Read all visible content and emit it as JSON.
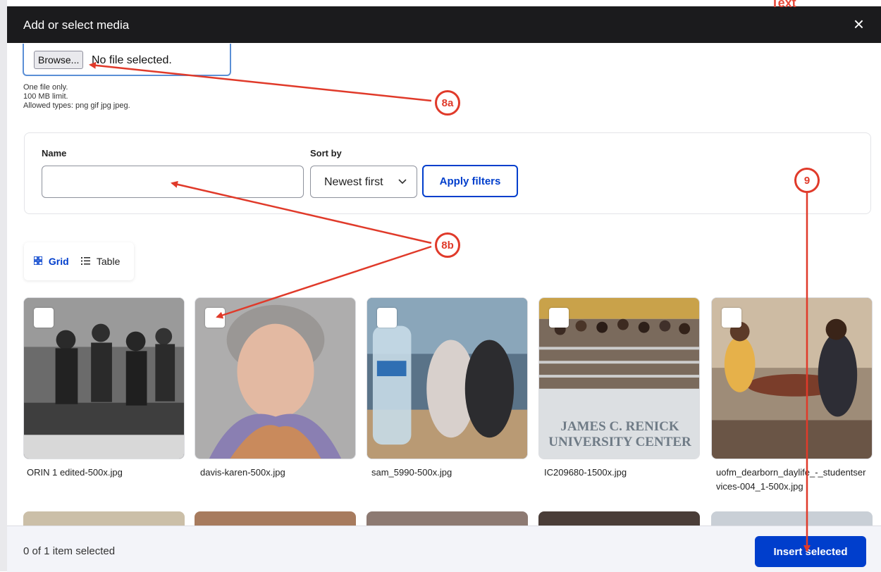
{
  "dialog": {
    "title": "Add or select media",
    "close_label": "×",
    "corner_text": "Text"
  },
  "upload": {
    "browse_label": "Browse...",
    "status": "No file selected.",
    "help": [
      "One file only.",
      "100 MB limit.",
      "Allowed types: png gif jpg jpeg."
    ]
  },
  "filters": {
    "name_label": "Name",
    "name_value": "",
    "sort_label": "Sort by",
    "sort_value": "Newest first",
    "apply_label": "Apply filters"
  },
  "view": {
    "grid_label": "Grid",
    "table_label": "Table",
    "active": "Grid"
  },
  "media": [
    {
      "filename": "ORIN 1 edited-500x.jpg"
    },
    {
      "filename": "davis-karen-500x.jpg"
    },
    {
      "filename": "sam_5990-500x.jpg"
    },
    {
      "filename": "IC209680-1500x.jpg",
      "sign_text": [
        "JAMES C. RENICK",
        "UNIVERSITY CENTER"
      ]
    },
    {
      "filename": "uofm_dearborn_daylife_-_studentservices-004_1-500x.jpg"
    }
  ],
  "footer": {
    "selection": "0 of 1 item selected",
    "insert_label": "Insert selected"
  },
  "annotations": {
    "a": "8a",
    "b": "8b",
    "c": "9"
  },
  "colors": {
    "accent": "#003ecc",
    "annotation": "#e03a2a",
    "header_bg": "#1b1b1d"
  }
}
